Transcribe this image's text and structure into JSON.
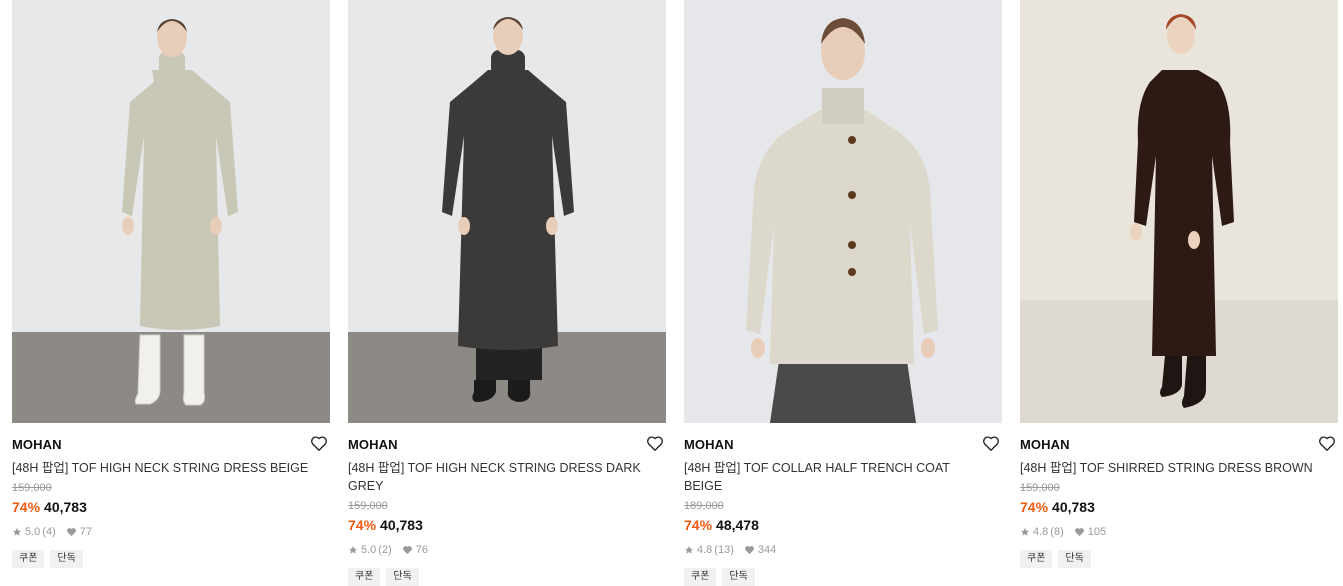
{
  "products": [
    {
      "brand": "MOHAN",
      "name": "[48H 팝업] TOF HIGH NECK STRING DRESS BEIGE",
      "original_price": "159,000",
      "discount": "74%",
      "price": "40,783",
      "rating": "5.0",
      "reviews": "(4)",
      "likes": "77",
      "tags": [
        "쿠폰",
        "단독"
      ],
      "image": {
        "bg": "#e7e8ea",
        "floor": "#8d8a86",
        "garment": "#c9c7b6",
        "shoes": "#f1f0ea",
        "pants": null
      }
    },
    {
      "brand": "MOHAN",
      "name": "[48H 팝업] TOF HIGH NECK STRING DRESS DARK GREY",
      "original_price": "159,000",
      "discount": "74%",
      "price": "40,783",
      "rating": "5.0",
      "reviews": "(2)",
      "likes": "76",
      "tags": [
        "쿠폰",
        "단독"
      ],
      "image": {
        "bg": "#e7e8ea",
        "floor": "#8d8a86",
        "garment": "#3b3a38",
        "shoes": "#1b1b1b",
        "pants": "#222222"
      }
    },
    {
      "brand": "MOHAN",
      "name": "[48H 팝업] TOF COLLAR HALF TRENCH COAT BEIGE",
      "original_price": "189,000",
      "discount": "74%",
      "price": "48,478",
      "rating": "4.8",
      "reviews": "(13)",
      "likes": "344",
      "tags": [
        "쿠폰",
        "단독"
      ],
      "image": {
        "bg": "#e6e7ea",
        "floor": "#e6e7ea",
        "garment": "#dcd8cb",
        "shoes": null,
        "pants": "#4a4a4a"
      }
    },
    {
      "brand": "MOHAN",
      "name": "[48H 팝업] TOF SHIRRED STRING DRESS BROWN",
      "original_price": "159,000",
      "discount": "74%",
      "price": "40,783",
      "rating": "4.8",
      "reviews": "(8)",
      "likes": "105",
      "tags": [
        "쿠폰",
        "단독"
      ],
      "image": {
        "bg": "#e9e5dc",
        "floor": "#dedad1",
        "garment": "#2e1a14",
        "shoes": "#1f1512",
        "pants": null
      }
    }
  ]
}
